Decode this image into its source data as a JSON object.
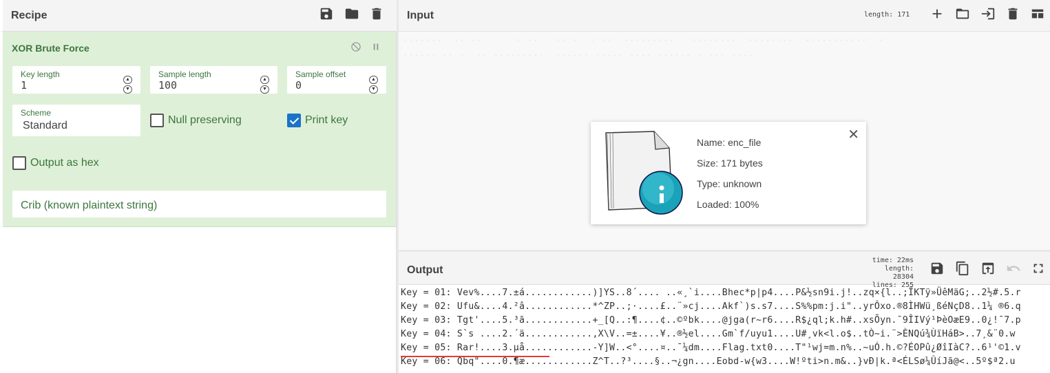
{
  "recipe": {
    "title": "Recipe",
    "operation": {
      "name": "XOR Brute Force",
      "key_length": {
        "label": "Key length",
        "value": "1"
      },
      "sample_length": {
        "label": "Sample length",
        "value": "100"
      },
      "sample_offset": {
        "label": "Sample offset",
        "value": "0"
      },
      "scheme": {
        "label": "Scheme",
        "value": "Standard"
      },
      "null_preserving": {
        "label": "Null preserving",
        "checked": false
      },
      "print_key": {
        "label": "Print key",
        "checked": true
      },
      "output_as_hex": {
        "label": "Output as hex",
        "checked": false
      },
      "crib": {
        "placeholder": "Crib (known plaintext string)"
      }
    }
  },
  "input": {
    "title": "Input",
    "length_label": "length:",
    "length_value": "171",
    "file": {
      "name": "Name: enc_file",
      "size": "Size: 171 bytes",
      "type": "Type: unknown",
      "loaded": "Loaded: 100%"
    }
  },
  "output": {
    "title": "Output",
    "time_label": "time:",
    "time_value": "22ms",
    "length_label": "length:",
    "length_value": "28304",
    "lines_label": "lines:",
    "lines_value": "255",
    "lines": [
      "Key = 01: Vev%....7.±á............)]YS..8´.... ..«¸`i....Bhec*p|p4....P&½sn9i.j!..zq×{l..;ÏKTÿ»ÜêMäG;..2½#.5.r",
      "Key = 02: Ufu&....4.²â............*^ZP..;·....£..¨»cj....Akf`)s.s7....S%%pm:j.i\"..yrÔxo.®8ÌHWü¸ßéNçD8..1¼ ®6.q",
      "Key = 03: Tgt'....5.³ã............+_[Q..:¶....¢..©ºbk....@jga(r~r6....R$¿ql;k.h#..xsÕyn.¯9ÎIVý¹ÞèOæE9..0¿!¯7.p",
      "Key = 04: S`s ....2.´ä............,X\\V..=±....¥..®½el....Gm`f/uyu1....U#¸vk<l.o$..tÒ~i.¨>ÈNQú¾ÙïHáB>..7¸&¨0.w",
      "Key = 05: Rar!....3.µå............-Y]W..<°....¤..¯¼dm....Flag.txt0....T\"¹wj=m.n%..~uÓ.h.©?ÉOPû¿ØîIàC?..6¹'©1.v",
      "Key = 06: Qbq\"....0.¶æ............Z^T..?³....§..¬¿gn....Eobd-w{w3....W!ºti>n.m&..}vÐ|k.ª<ÉLSø¼ÛíJã@<..5º$ª2.u"
    ]
  },
  "colors": {
    "op_bg": "#dff0d8",
    "op_text": "#3c763d",
    "checkbox_on": "#1a73c9",
    "highlight_underline": "#e53935",
    "file_icon_accent": "#1aa3b8"
  }
}
